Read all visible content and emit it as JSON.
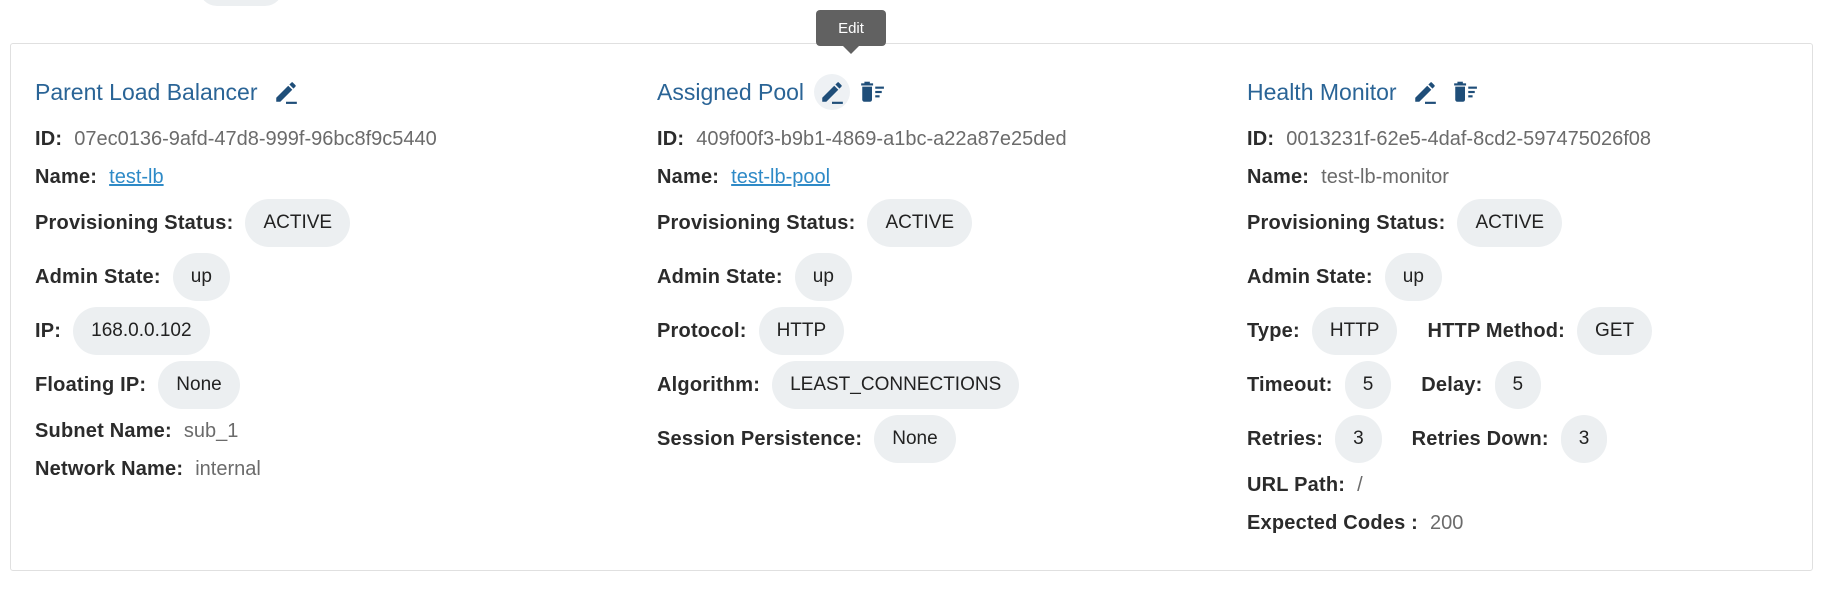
{
  "colors": {
    "title": "#2a6496",
    "link": "#2e8ac7",
    "chip_bg": "#eceff1",
    "icon": "#1f4e79",
    "tooltip_bg": "#616161"
  },
  "tooltip": "Edit",
  "load_balancer": {
    "title": "Parent Load Balancer",
    "id_label": "ID:",
    "id": "07ec0136-9afd-47d8-999f-96bc8f9c5440",
    "name_label": "Name:",
    "name": "test-lb",
    "prov_label": "Provisioning Status:",
    "prov": "ACTIVE",
    "admin_label": "Admin State:",
    "admin": "up",
    "ip_label": "IP:",
    "ip": "168.0.0.102",
    "fip_label": "Floating IP:",
    "fip": "None",
    "subnet_label": "Subnet Name:",
    "subnet": "sub_1",
    "network_label": "Network Name:",
    "network": "internal"
  },
  "pool": {
    "title": "Assigned Pool",
    "id_label": "ID:",
    "id": "409f00f3-b9b1-4869-a1bc-a22a87e25ded",
    "name_label": "Name:",
    "name": "test-lb-pool",
    "prov_label": "Provisioning Status:",
    "prov": "ACTIVE",
    "admin_label": "Admin State:",
    "admin": "up",
    "protocol_label": "Protocol:",
    "protocol": "HTTP",
    "algorithm_label": "Algorithm:",
    "algorithm": "LEAST_CONNECTIONS",
    "session_label": "Session Persistence:",
    "session": "None"
  },
  "monitor": {
    "title": "Health Monitor",
    "id_label": "ID:",
    "id": "0013231f-62e5-4daf-8cd2-597475026f08",
    "name_label": "Name:",
    "name": "test-lb-monitor",
    "prov_label": "Provisioning Status:",
    "prov": "ACTIVE",
    "admin_label": "Admin State:",
    "admin": "up",
    "type_label": "Type:",
    "type": "HTTP",
    "method_label": "HTTP Method:",
    "method": "GET",
    "timeout_label": "Timeout:",
    "timeout": "5",
    "delay_label": "Delay:",
    "delay": "5",
    "retries_label": "Retries:",
    "retries": "3",
    "retries_down_label": "Retries Down:",
    "retries_down": "3",
    "url_label": "URL Path:",
    "url": "/",
    "codes_label": "Expected Codes :",
    "codes": "200"
  }
}
